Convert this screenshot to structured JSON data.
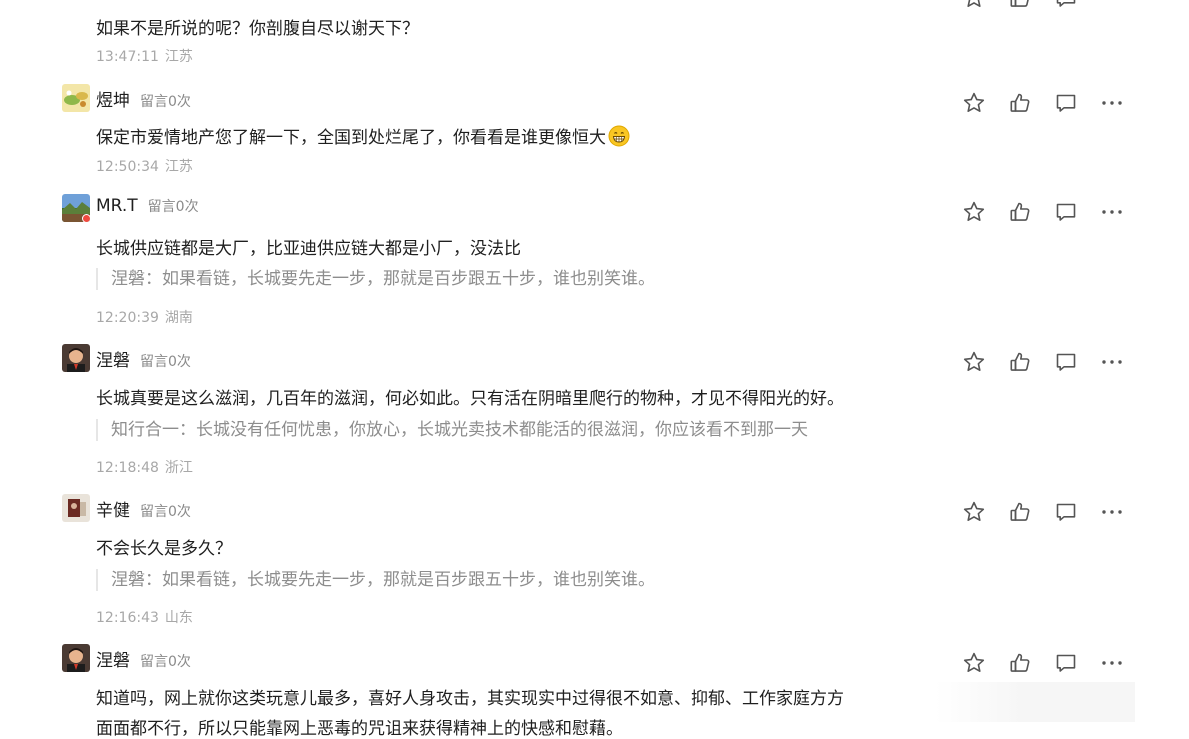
{
  "comments": [
    {
      "text": "如果不是所说的呢？你剖腹自尽以谢天下？",
      "time": "13:47:11",
      "region": "江苏"
    },
    {
      "username": "煜坤",
      "count": "留言0次",
      "avatar_icon": "landscape-avatar",
      "text": "保定市爱情地产您了解一下，全国到处烂尾了，你看看是谁更像恒大",
      "emoji_icon": "grinning-face-icon",
      "time": "12:50:34",
      "region": "江苏"
    },
    {
      "username": "MR.T",
      "count": "留言0次",
      "avatar_icon": "scenery-avatar",
      "text": "长城供应链都是大厂，比亚迪供应链大都是小厂，没法比",
      "quote": "涅磐：如果看链，长城要先走一步，那就是百步跟五十步，谁也别笑谁。",
      "time": "12:20:39",
      "region": "湖南"
    },
    {
      "username": "涅磐",
      "count": "留言0次",
      "avatar_icon": "cartoon-man-avatar",
      "text": "长城真要是这么滋润，几百年的滋润，何必如此。只有活在阴暗里爬行的物种，才见不得阳光的好。",
      "quote": "知行合一：长城没有任何忧患，你放心，长城光卖技术都能活的很滋润，你应该看不到那一天",
      "time": "12:18:48",
      "region": "浙江"
    },
    {
      "username": "辛健",
      "count": "留言0次",
      "avatar_icon": "photo-avatar",
      "text": "不会长久是多久？",
      "quote": "涅磐：如果看链，长城要先走一步，那就是百步跟五十步，谁也别笑谁。",
      "time": "12:16:43",
      "region": "山东"
    },
    {
      "username": "涅磐",
      "count": "留言0次",
      "avatar_icon": "cartoon-man-avatar",
      "text_line1": "知道吗，网上就你这类玩意儿最多，喜好人身攻击，其实现实中过得很不如意、抑郁、工作家庭方方",
      "text_line2": "面面都不行，所以只能靠网上恶毒的咒诅来获得精神上的快感和慰藉。"
    }
  ],
  "action_icons": [
    "star-icon",
    "thumbs-up-icon",
    "comment-icon",
    "more-icon"
  ]
}
